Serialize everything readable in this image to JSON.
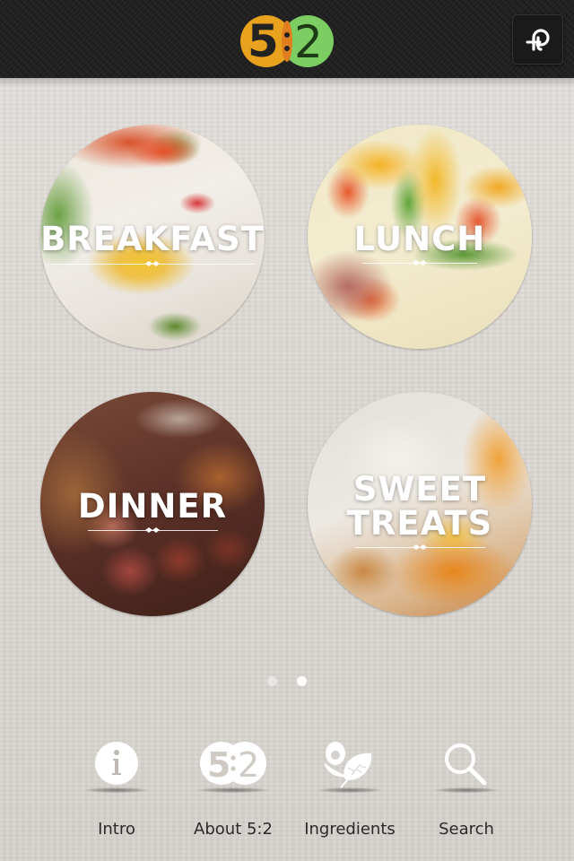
{
  "header": {
    "logo": {
      "left_digit": "5",
      "right_digit": "2",
      "colors": {
        "left": "#e8a21e",
        "right": "#7ccd62"
      }
    },
    "share_button": {
      "icon": "pinterest-p-icon"
    }
  },
  "tiles": [
    {
      "id": "breakfast",
      "label": "BREAKFAST",
      "image": "fried-egg-photo"
    },
    {
      "id": "lunch",
      "label": "LUNCH",
      "image": "peppers-scrambled-egg-photo"
    },
    {
      "id": "dinner",
      "label": "DINNER",
      "image": "roast-lamb-shallots-photo"
    },
    {
      "id": "sweet",
      "label": "SWEET\nTREATS",
      "image": "baked-peach-yogurt-photo"
    }
  ],
  "pager": {
    "current_page": 2,
    "total_pages": 2
  },
  "bottom_nav": [
    {
      "label": "Intro",
      "icon": "info-icon"
    },
    {
      "label": "About 5:2",
      "icon": "five-two-logo-icon"
    },
    {
      "label": "Ingredients",
      "icon": "egg-leaf-icon"
    },
    {
      "label": "Search",
      "icon": "search-icon"
    }
  ]
}
